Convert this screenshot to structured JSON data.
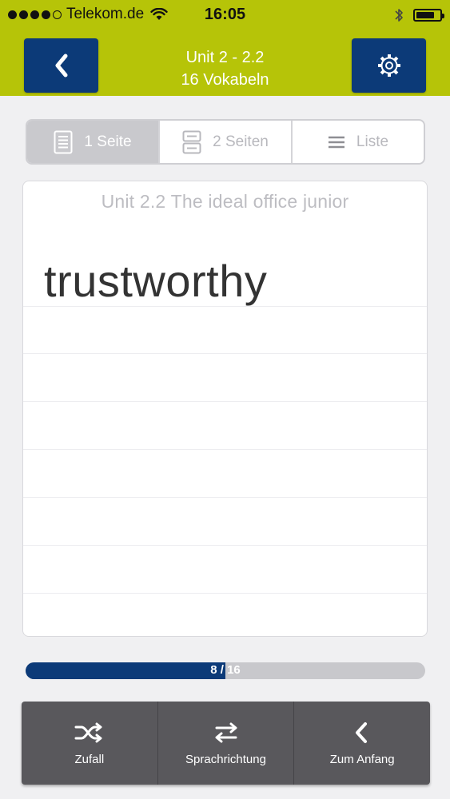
{
  "status_bar": {
    "carrier": "Telekom.de",
    "time": "16:05",
    "signal_dots_filled": 4,
    "signal_dots_total": 5,
    "battery_level": 0.78
  },
  "nav": {
    "title": "Unit 2 - 2.2",
    "subtitle": "16 Vokabeln",
    "back_icon": "chevron-left-icon",
    "settings_icon": "gear-icon"
  },
  "view_modes": [
    {
      "label": "1 Seite",
      "icon": "single-page-icon",
      "active": true
    },
    {
      "label": "2 Seiten",
      "icon": "two-pages-icon",
      "active": false
    },
    {
      "label": "Liste",
      "icon": "list-icon",
      "active": false
    }
  ],
  "card": {
    "heading": "Unit 2.2 The ideal office junior",
    "word": "trustworthy"
  },
  "progress": {
    "label": "8 / 16",
    "current": 8,
    "total": 16
  },
  "toolbar": {
    "shuffle_label": "Zufall",
    "direction_label": "Sprachrichtung",
    "restart_label": "Zum Anfang"
  },
  "colors": {
    "accent_lime": "#b6c408",
    "navy": "#0c3a78",
    "toolbar_gray": "#59585c"
  }
}
